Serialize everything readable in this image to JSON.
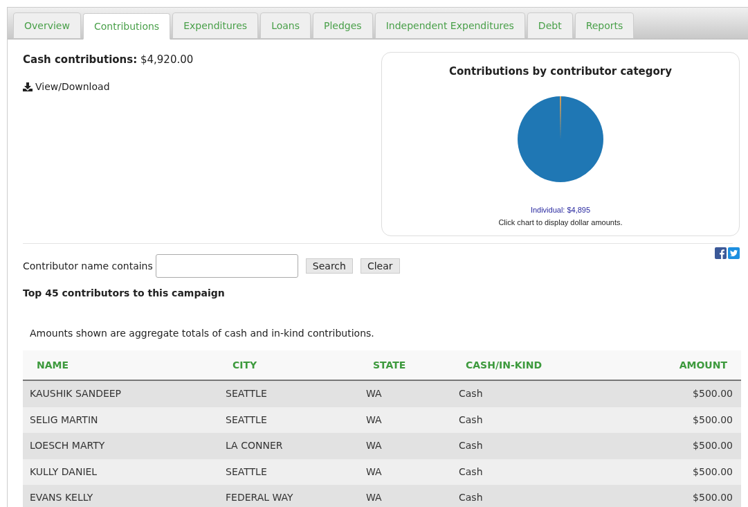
{
  "tabs": [
    {
      "label": "Overview",
      "selected": false
    },
    {
      "label": "Contributions",
      "selected": true
    },
    {
      "label": "Expenditures",
      "selected": false
    },
    {
      "label": "Loans",
      "selected": false
    },
    {
      "label": "Pledges",
      "selected": false
    },
    {
      "label": "Independent Expenditures",
      "selected": false
    },
    {
      "label": "Debt",
      "selected": false
    },
    {
      "label": "Reports",
      "selected": false
    }
  ],
  "summary": {
    "label": "Cash contributions:",
    "value": "$4,920.00"
  },
  "download_link": "View/Download",
  "chart_card": {
    "title": "Contributions by contributor category",
    "legend": "Individual: $4,895",
    "hint": "Click chart to display dollar amounts."
  },
  "search": {
    "label": "Contributor name contains",
    "buttons": [
      "Search",
      "Clear"
    ]
  },
  "heading": "Top 45 contributors to this campaign",
  "note": "Amounts shown are aggregate totals of cash and in-kind contributions.",
  "table": {
    "columns": [
      "NAME",
      "CITY",
      "STATE",
      "CASH/IN-KIND",
      "AMOUNT"
    ],
    "rows": [
      [
        "KAUSHIK SANDEEP",
        "SEATTLE",
        "WA",
        "Cash",
        "$500.00"
      ],
      [
        "SELIG MARTIN",
        "SEATTLE",
        "WA",
        "Cash",
        "$500.00"
      ],
      [
        "LOESCH MARTY",
        "LA CONNER",
        "WA",
        "Cash",
        "$500.00"
      ],
      [
        "KULLY DANIEL",
        "SEATTLE",
        "WA",
        "Cash",
        "$500.00"
      ],
      [
        "EVANS KELLY",
        "FEDERAL WAY",
        "WA",
        "Cash",
        "$500.00"
      ]
    ]
  }
}
